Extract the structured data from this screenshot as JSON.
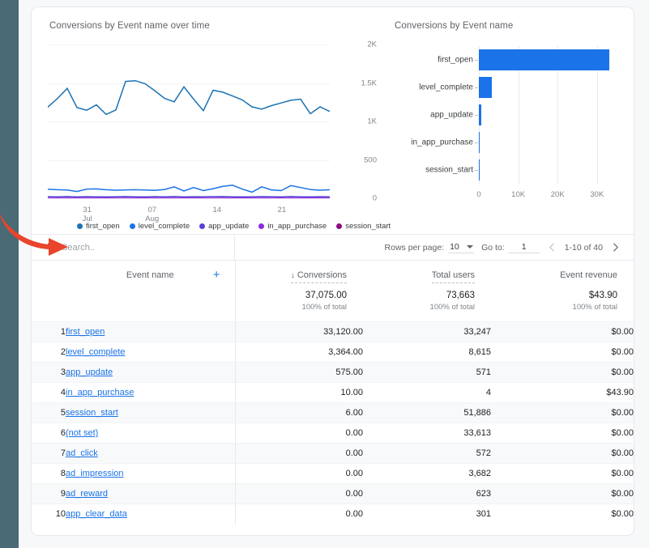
{
  "line_card": {
    "title": "Conversions by Event name over time"
  },
  "bar_card": {
    "title": "Conversions by Event name"
  },
  "search": {
    "placeholder": "Search..",
    "value": "",
    "icon": "search-icon"
  },
  "pagination": {
    "rows_per_page_label": "Rows per page:",
    "rows_per_page_value": "10",
    "goto_label": "Go to:",
    "goto_value": "1",
    "range": "1-10 of 40",
    "prev_icon": "chevron-left-icon",
    "next_icon": "chevron-right-icon",
    "dropdown_icon": "chevron-down-icon"
  },
  "table": {
    "headers": {
      "event_name": "Event name",
      "conversions": "Conversions",
      "total_users": "Total users",
      "event_revenue": "Event revenue",
      "sort_indicator": "↓",
      "add_icon": "plus-icon"
    },
    "summary": {
      "conversions": "37,075.00",
      "conversions_sub": "100% of total",
      "total_users": "73,663",
      "total_users_sub": "100% of total",
      "event_revenue": "$43.90",
      "event_revenue_sub": "100% of total"
    },
    "rows": [
      {
        "idx": "1",
        "name": "first_open",
        "conversions": "33,120.00",
        "total_users": "33,247",
        "event_revenue": "$0.00"
      },
      {
        "idx": "2",
        "name": "level_complete",
        "conversions": "3,364.00",
        "total_users": "8,615",
        "event_revenue": "$0.00"
      },
      {
        "idx": "3",
        "name": "app_update",
        "conversions": "575.00",
        "total_users": "571",
        "event_revenue": "$0.00"
      },
      {
        "idx": "4",
        "name": "in_app_purchase",
        "conversions": "10.00",
        "total_users": "4",
        "event_revenue": "$43.90"
      },
      {
        "idx": "5",
        "name": "session_start",
        "conversions": "6.00",
        "total_users": "51,886",
        "event_revenue": "$0.00"
      },
      {
        "idx": "6",
        "name": "(not set)",
        "conversions": "0.00",
        "total_users": "33,613",
        "event_revenue": "$0.00"
      },
      {
        "idx": "7",
        "name": "ad_click",
        "conversions": "0.00",
        "total_users": "572",
        "event_revenue": "$0.00"
      },
      {
        "idx": "8",
        "name": "ad_impression",
        "conversions": "0.00",
        "total_users": "3,682",
        "event_revenue": "$0.00"
      },
      {
        "idx": "9",
        "name": "ad_reward",
        "conversions": "0.00",
        "total_users": "623",
        "event_revenue": "$0.00"
      },
      {
        "idx": "10",
        "name": "app_clear_data",
        "conversions": "0.00",
        "total_users": "301",
        "event_revenue": "$0.00"
      }
    ]
  },
  "colors": {
    "first_open": "#1b72b3",
    "level_complete": "#1a73e8",
    "app_update": "#5b3fd6",
    "in_app_purchase": "#8a2be2",
    "session_start": "#8b0a84",
    "bar": "#1a73e8",
    "link": "#1a73e8",
    "annotation_arrow": "#e8452c",
    "left_strip": "#4a6a75"
  },
  "chart_data": [
    {
      "type": "line",
      "title": "Conversions by Event name over time",
      "xlabel": "",
      "ylabel": "",
      "ylim": [
        0,
        2000
      ],
      "yticks": [
        "0",
        "500",
        "1K",
        "1.5K",
        "2K"
      ],
      "xticks": [
        {
          "day": "31",
          "month": "Jul"
        },
        {
          "day": "07",
          "month": "Aug"
        },
        {
          "day": "14",
          "month": ""
        },
        {
          "day": "21",
          "month": ""
        }
      ],
      "grid": true,
      "legend_position": "bottom",
      "series": [
        {
          "name": "first_open",
          "color": "#1b72b3",
          "values": [
            1185,
            1300,
            1430,
            1180,
            1145,
            1215,
            1090,
            1150,
            1520,
            1530,
            1490,
            1400,
            1300,
            1255,
            1450,
            1290,
            1140,
            1405,
            1380,
            1330,
            1280,
            1190,
            1160,
            1205,
            1240,
            1275,
            1290,
            1100,
            1190,
            1130
          ]
        },
        {
          "name": "level_complete",
          "color": "#1a73e8",
          "values": [
            118,
            112,
            108,
            88,
            120,
            122,
            112,
            105,
            110,
            112,
            108,
            104,
            115,
            150,
            95,
            140,
            100,
            125,
            155,
            170,
            120,
            80,
            150,
            110,
            100,
            165,
            140,
            115,
            105,
            112
          ]
        },
        {
          "name": "app_update",
          "color": "#5b3fd6",
          "values": [
            22,
            20,
            24,
            18,
            22,
            20,
            19,
            21,
            23,
            20,
            18,
            22,
            20,
            24,
            19,
            21,
            20,
            22,
            23,
            20,
            18,
            20,
            22,
            21,
            19,
            23,
            20,
            18,
            21,
            20
          ]
        },
        {
          "name": "in_app_purchase",
          "color": "#8a2be2",
          "values": [
            3,
            2,
            4,
            1,
            3,
            2,
            3,
            2,
            4,
            3,
            2,
            3,
            2,
            4,
            3,
            2,
            3,
            2,
            4,
            3,
            2,
            3,
            2,
            3,
            2,
            4,
            3,
            2,
            3,
            2
          ]
        },
        {
          "name": "session_start",
          "color": "#8b0a84",
          "values": [
            1,
            1,
            1,
            0,
            1,
            1,
            1,
            0,
            1,
            1,
            1,
            0,
            1,
            1,
            1,
            0,
            1,
            1,
            1,
            0,
            1,
            1,
            1,
            0,
            1,
            1,
            1,
            0,
            1,
            1
          ]
        }
      ]
    },
    {
      "type": "bar",
      "orientation": "horizontal",
      "title": "Conversions by Event name",
      "categories": [
        "first_open",
        "level_complete",
        "app_update",
        "in_app_purchase",
        "session_start"
      ],
      "values": [
        33120,
        3364,
        575,
        10,
        6
      ],
      "xticks": [
        "0",
        "10K",
        "20K",
        "30K"
      ],
      "xlim": [
        0,
        36000
      ],
      "color": "#1a73e8",
      "grid": true
    }
  ]
}
